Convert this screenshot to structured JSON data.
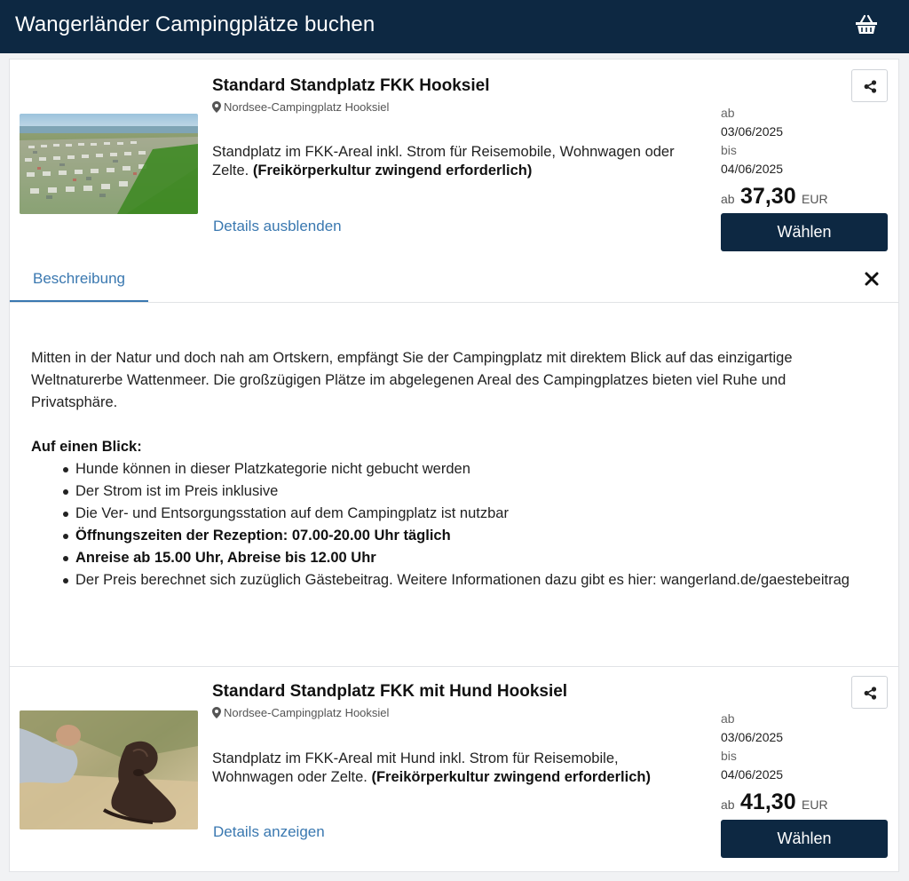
{
  "header": {
    "title": "Wangerländer Campingplätze buchen",
    "basket_icon": "basket-icon"
  },
  "products": [
    {
      "title": "Standard Standplatz FKK Hooksiel",
      "location": "Nordsee-Campingplatz Hooksiel",
      "description": "Standplatz im FKK-Areal inkl. Strom für Reisemobile, Wohnwagen oder Zelte.",
      "description_bold": "(Freikörperkultur zwingend erforderlich)",
      "details_link": "Details ausblenden",
      "from_label": "ab",
      "from_date": "03/06/2025",
      "to_label": "bis",
      "to_date": "04/06/2025",
      "price_prefix": "ab",
      "price": "37,30",
      "currency": "EUR",
      "choose_label": "Wählen",
      "image": "campsite-aerial-photo"
    },
    {
      "title": "Standard Standplatz FKK mit Hund Hooksiel",
      "location": "Nordsee-Campingplatz Hooksiel",
      "description": "Standplatz im FKK-Areal mit Hund inkl. Strom für Reisemobile, Wohnwagen oder Zelte.",
      "description_bold": "(Freikörperkultur zwingend erforderlich)",
      "details_link": "Details anzeigen",
      "from_label": "ab",
      "from_date": "03/06/2025",
      "to_label": "bis",
      "to_date": "04/06/2025",
      "price_prefix": "ab",
      "price": "41,30",
      "currency": "EUR",
      "choose_label": "Wählen",
      "image": "dog-on-beach-photo"
    }
  ],
  "details": {
    "tab_label": "Beschreibung",
    "intro": "Mitten in der Natur und doch nah am Ortskern, empfängt Sie der Campingplatz mit direktem Blick auf das einzigartige Weltnaturerbe Wattenmeer. Die großzügigen Plätze im abgelegenen Areal des Campingplatzes bieten viel Ruhe und Privatsphäre.",
    "heading": "Auf einen Blick:",
    "bullets": [
      "Hunde können in dieser Platzkategorie nicht gebucht werden",
      "Der Strom ist im Preis inklusive",
      "Die Ver- und Entsorgungsstation auf dem Campingplatz ist nutzbar",
      "Öffnungszeiten der Rezeption: 07.00-20.00 Uhr täglich",
      "Anreise ab 15.00 Uhr, Abreise bis 12.00 Uhr",
      "Der Preis berechnet sich zuzüglich Gästebeitrag. Weitere Informationen dazu gibt es hier: wangerland.de/gaestebeitrag"
    ]
  },
  "colors": {
    "header_bg": "#0d2842",
    "accent_link": "#3a78b0",
    "button_bg": "#0d2842"
  }
}
